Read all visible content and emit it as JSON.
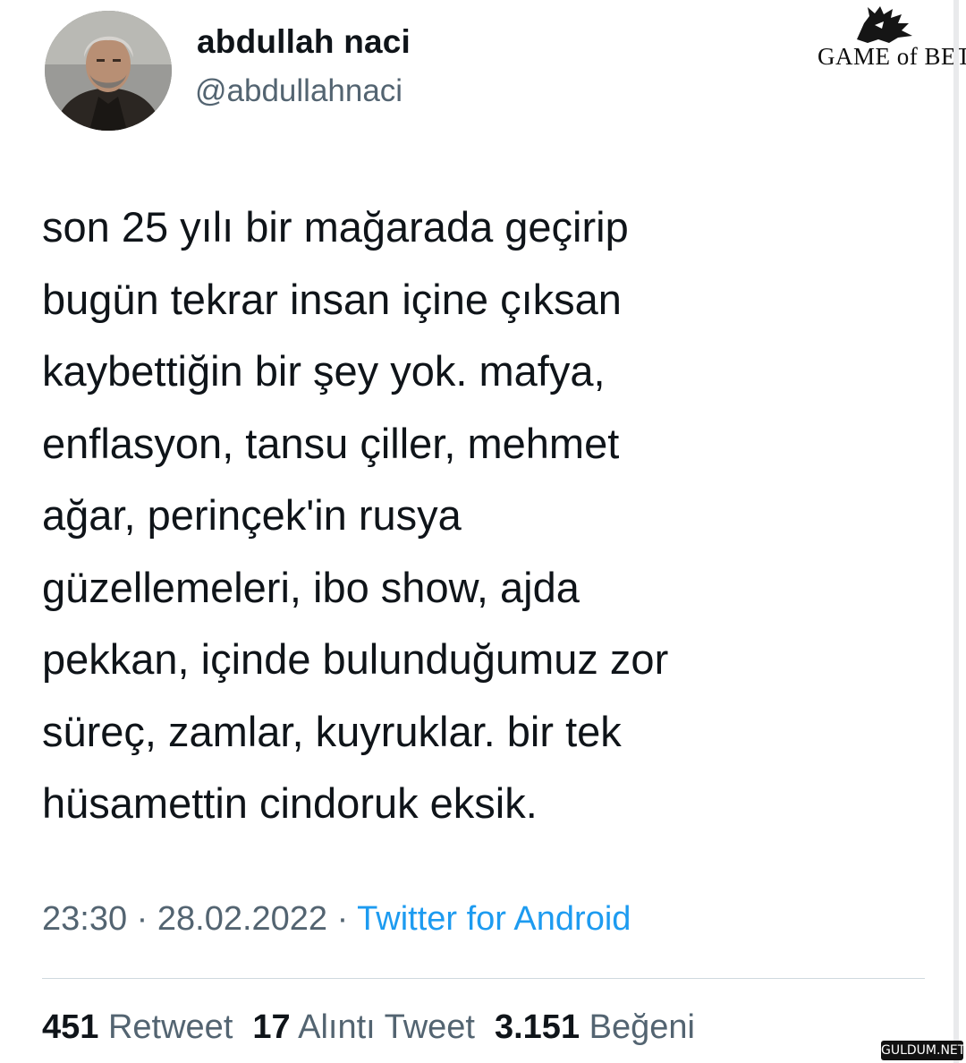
{
  "user": {
    "display_name": "abdullah naci",
    "handle": "@abdullahnaci"
  },
  "tweet": {
    "lines": [
      "son 25 yılı bir mağarada geçirip",
      "bugün tekrar insan içine çıksan",
      "kaybettiğin bir şey yok. mafya,",
      "enflasyon, tansu çiller, mehmet",
      "ağar, perinçek'in rusya",
      "güzellemeleri, ibo show, ajda",
      "pekkan, içinde bulunduğumuz zor",
      "süreç, zamlar, kuyruklar. bir tek",
      "hüsamettin cindoruk eksik."
    ],
    "time": "23:30",
    "separator": "·",
    "date": "28.02.2022",
    "source": "Twitter for Android"
  },
  "stats": {
    "retweets": "451",
    "retweets_label": "Retweet",
    "quotes": "17",
    "quotes_label": "Alıntı Tweet",
    "likes": "3.151",
    "likes_label": "Beğeni"
  },
  "brand": {
    "logo_text": "GAME of BET",
    "logo_icon": "wolf-sigil-icon",
    "watermark": "GULDUM.NET"
  },
  "colors": {
    "text": "#0f1419",
    "secondary": "#536471",
    "link": "#1d9bf0",
    "divider": "#cfd9de"
  }
}
